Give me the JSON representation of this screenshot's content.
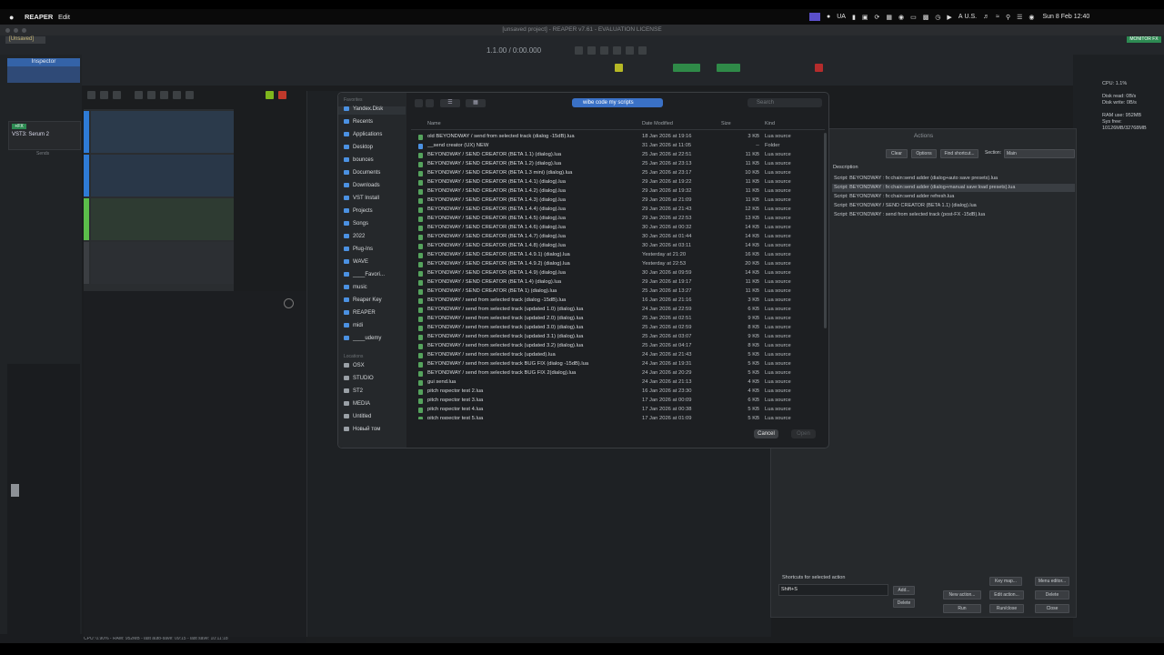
{
  "menubar": {
    "app": "REAPER",
    "menu": [
      "Edit"
    ],
    "tray": [
      "UA",
      "U.S."
    ],
    "clock": "Sun 8 Feb 12:40"
  },
  "window": {
    "title": "[unsaved project] - REAPER v7.61 - EVALUATION LICENSE",
    "tab": "[Unsaved]",
    "time_display": "1.1.00 / 0:00.000",
    "monitor": "MONITOR FX"
  },
  "inspector": {
    "tab": "Inspector",
    "fx_label": "+FX",
    "fx_item": "VST3: Serum 2",
    "sends": "Sends"
  },
  "stats": {
    "lines": [
      "CPU: 1.1%",
      "",
      "Disk read: 0B/s",
      "Disk write: 0B/s",
      "",
      "RAM use: 952MB",
      "Sys free: 10126MB/32768MB"
    ]
  },
  "status": "CPU: 0.90% - RAM: 952MB - last auto-save: 09:15 - last save: 10:11:18",
  "actions": {
    "title": "Actions",
    "buttons": {
      "clear": "Clear",
      "options": "Options",
      "find_shortcut": "Find shortcut...",
      "section_label": "Section:",
      "section_value": "Main"
    },
    "column": "Description",
    "rows": [
      "Script: BEYONDWAY : fx:chain:send adder (dialog+auto save presets).lua",
      "Script: BEYONDWAY : fx:chain:send adder (dialog+manual save:load presets).lua",
      "Script: BEYONDWAY : fx:chain:send adder refresh.lua",
      "Script: BEYONDWAY / SEND CREATOR (BETA 1.1) (dialog).lua",
      "Script: BEYONDWAY : send from selected track (post-FX -15dB).lua"
    ],
    "shortcuts_label": "Shortcuts for selected action",
    "shortcut_value": "Shift+S",
    "bottom": {
      "add": "Add...",
      "delete_sc": "Delete",
      "key_map": "Key map...",
      "menu_editor": "Menu editor...",
      "new_action": "New action...",
      "edit_action": "Edit action...",
      "delete": "Delete",
      "run": "Run",
      "run_close": "Run/close",
      "close": "Close"
    }
  },
  "dialog": {
    "sidebar": {
      "favorites_label": "Favorites",
      "favorites": [
        "Yandex.Disk",
        "Recents",
        "Applications",
        "Desktop",
        "bounces",
        "Documents",
        "Downloads",
        "VST Install",
        "Projects",
        "Songs",
        "2022",
        "Plug-Ins",
        "WAVE",
        "____Favori...",
        "music",
        "Reaper Key",
        "REAPER",
        "midi",
        "____udemy"
      ],
      "locations_label": "Locations",
      "locations": [
        "OSX",
        "STUDIO",
        "ST2",
        "MEDIA",
        "Untitled",
        "Новый том"
      ]
    },
    "folder": "wibe code my scripts",
    "search_placeholder": "Search",
    "columns": {
      "name": "Name",
      "date": "Date Modified",
      "size": "Size",
      "kind": "Kind"
    },
    "files": [
      {
        "name": "old BEYONDWAY / send from selected track (dialog -15dB).lua",
        "date": "18 Jan 2026 at 19:16",
        "size": "3 KB",
        "kind": "Lua source",
        "type": "file"
      },
      {
        "name": "__send creator (UX) NEW",
        "date": "31 Jan 2026 at 11:05",
        "size": "--",
        "kind": "Folder",
        "type": "folder"
      },
      {
        "name": "BEYONDWAY / SEND CREATOR (BETA 1.1) (dialog).lua",
        "date": "25 Jan 2026 at 22:51",
        "size": "11 KB",
        "kind": "Lua source",
        "type": "file"
      },
      {
        "name": "BEYONDWAY / SEND CREATOR (BETA 1.2) (dialog).lua",
        "date": "25 Jan 2026 at 23:13",
        "size": "11 KB",
        "kind": "Lua source",
        "type": "file"
      },
      {
        "name": "BEYONDWAY / SEND CREATOR (BETA 1.3 mini) (dialog).lua",
        "date": "25 Jan 2026 at 23:17",
        "size": "10 KB",
        "kind": "Lua source",
        "type": "file"
      },
      {
        "name": "BEYONDWAY / SEND CREATOR (BETA 1.4.1) (dialog).lua",
        "date": "29 Jan 2026 at 19:22",
        "size": "11 KB",
        "kind": "Lua source",
        "type": "file"
      },
      {
        "name": "BEYONDWAY / SEND CREATOR (BETA 1.4.2) (dialog).lua",
        "date": "29 Jan 2026 at 19:32",
        "size": "11 KB",
        "kind": "Lua source",
        "type": "file"
      },
      {
        "name": "BEYONDWAY / SEND CREATOR (BETA 1.4.3) (dialog).lua",
        "date": "29 Jan 2026 at 21:09",
        "size": "11 KB",
        "kind": "Lua source",
        "type": "file"
      },
      {
        "name": "BEYONDWAY / SEND CREATOR (BETA 1.4.4) (dialog).lua",
        "date": "29 Jan 2026 at 21:43",
        "size": "12 KB",
        "kind": "Lua source",
        "type": "file"
      },
      {
        "name": "BEYONDWAY / SEND CREATOR (BETA 1.4.5) (dialog).lua",
        "date": "29 Jan 2026 at 22:53",
        "size": "13 KB",
        "kind": "Lua source",
        "type": "file"
      },
      {
        "name": "BEYONDWAY / SEND CREATOR (BETA 1.4.6) (dialog).lua",
        "date": "30 Jan 2026 at 00:32",
        "size": "14 KB",
        "kind": "Lua source",
        "type": "file"
      },
      {
        "name": "BEYONDWAY / SEND CREATOR (BETA 1.4.7) (dialog).lua",
        "date": "30 Jan 2026 at 01:44",
        "size": "14 KB",
        "kind": "Lua source",
        "type": "file"
      },
      {
        "name": "BEYONDWAY / SEND CREATOR (BETA 1.4.8) (dialog).lua",
        "date": "30 Jan 2026 at 03:11",
        "size": "14 KB",
        "kind": "Lua source",
        "type": "file"
      },
      {
        "name": "BEYONDWAY / SEND CREATOR (BETA 1.4.9.1) (dialog).lua",
        "date": "Yesterday at 21:20",
        "size": "16 KB",
        "kind": "Lua source",
        "type": "file"
      },
      {
        "name": "BEYONDWAY / SEND CREATOR (BETA 1.4.9.2) (dialog).lua",
        "date": "Yesterday at 22:53",
        "size": "20 KB",
        "kind": "Lua source",
        "type": "file"
      },
      {
        "name": "BEYONDWAY / SEND CREATOR (BETA 1.4.9) (dialog).lua",
        "date": "30 Jan 2026 at 09:59",
        "size": "14 KB",
        "kind": "Lua source",
        "type": "file"
      },
      {
        "name": "BEYONDWAY / SEND CREATOR (BETA 1.4) (dialog).lua",
        "date": "29 Jan 2026 at 19:17",
        "size": "11 KB",
        "kind": "Lua source",
        "type": "file"
      },
      {
        "name": "BEYONDWAY / SEND CREATOR (BETA 1) (dialog).lua",
        "date": "25 Jan 2026 at 13:27",
        "size": "11 KB",
        "kind": "Lua source",
        "type": "file"
      },
      {
        "name": "BEYONDWAY / send from selected track (dialog -15dB).lua",
        "date": "16 Jan 2026 at 21:16",
        "size": "3 KB",
        "kind": "Lua source",
        "type": "file"
      },
      {
        "name": "BEYONDWAY / send from selected track (updated 1.0) (dialog).lua",
        "date": "24 Jan 2026 at 22:59",
        "size": "6 KB",
        "kind": "Lua source",
        "type": "file"
      },
      {
        "name": "BEYONDWAY / send from selected track (updated 2.0) (dialog).lua",
        "date": "25 Jan 2026 at 02:51",
        "size": "9 KB",
        "kind": "Lua source",
        "type": "file"
      },
      {
        "name": "BEYONDWAY / send from selected track (updated 3.0) (dialog).lua",
        "date": "25 Jan 2026 at 02:59",
        "size": "8 KB",
        "kind": "Lua source",
        "type": "file"
      },
      {
        "name": "BEYONDWAY / send from selected track (updated 3.1) (dialog).lua",
        "date": "25 Jan 2026 at 03:07",
        "size": "9 KB",
        "kind": "Lua source",
        "type": "file"
      },
      {
        "name": "BEYONDWAY / send from selected track (updated 3.2) (dialog).lua",
        "date": "25 Jan 2026 at 04:17",
        "size": "8 KB",
        "kind": "Lua source",
        "type": "file"
      },
      {
        "name": "BEYONDWAY / send from selected track (updated).lua",
        "date": "24 Jan 2026 at 21:43",
        "size": "5 KB",
        "kind": "Lua source",
        "type": "file"
      },
      {
        "name": "BEYONDWAY / send from selected track BUG FIX (dialog -15dB).lua",
        "date": "24 Jan 2026 at 19:31",
        "size": "5 KB",
        "kind": "Lua source",
        "type": "file"
      },
      {
        "name": "BEYONDWAY / send from selected track BUG FIX 2(dialog).lua",
        "date": "24 Jan 2026 at 20:29",
        "size": "5 KB",
        "kind": "Lua source",
        "type": "file"
      },
      {
        "name": "gui send.lua",
        "date": "24 Jan 2026 at 21:13",
        "size": "4 KB",
        "kind": "Lua source",
        "type": "file"
      },
      {
        "name": "pitch nspector test 2.lua",
        "date": "16 Jan 2026 at 23:30",
        "size": "4 KB",
        "kind": "Lua source",
        "type": "file"
      },
      {
        "name": "pitch nspector test 3.lua",
        "date": "17 Jan 2026 at 00:09",
        "size": "6 KB",
        "kind": "Lua source",
        "type": "file"
      },
      {
        "name": "pitch nspector test 4.lua",
        "date": "17 Jan 2026 at 00:38",
        "size": "5 KB",
        "kind": "Lua source",
        "type": "file"
      },
      {
        "name": "pitch nspector test 5.lua",
        "date": "17 Jan 2026 at 01:09",
        "size": "5 KB",
        "kind": "Lua source",
        "type": "file"
      }
    ],
    "cancel": "Cancel",
    "open": "Open"
  },
  "colors": {
    "accent": "#3a71c6",
    "inspector": "#3463a8",
    "track_blue": "#2e7bd6",
    "track_green": "#5bbd4a",
    "record": "#d0302e"
  }
}
